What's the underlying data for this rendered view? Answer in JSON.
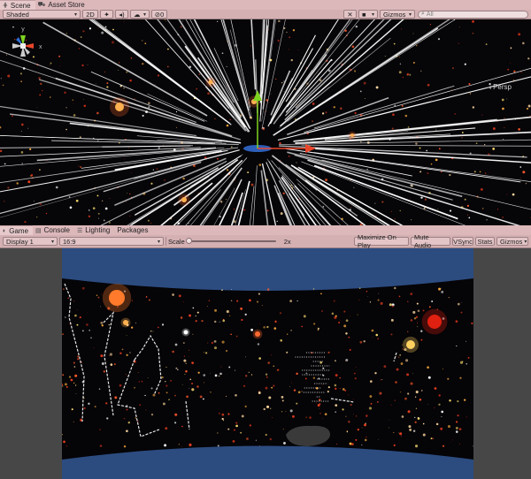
{
  "scene_panel": {
    "tabs": [
      {
        "label": "Scene",
        "icon": "grid-icon",
        "active": true
      },
      {
        "label": "Asset Store",
        "icon": "shopping-cart-icon",
        "active": false
      }
    ],
    "toolbar": {
      "shading_mode": "Shaded",
      "mode_2d": "2D",
      "gizmos": "Gizmos",
      "search_placeholder": "All",
      "hidden_count": "0"
    },
    "persp_label": "Persp",
    "axis_labels": {
      "y": "y",
      "x": "x"
    }
  },
  "game_panel": {
    "tabs": [
      {
        "label": "Game",
        "icon": "game-controller-icon",
        "active": true
      },
      {
        "label": "Console",
        "icon": "console-icon",
        "active": false
      },
      {
        "label": "Lighting",
        "icon": "lighting-icon",
        "active": false
      },
      {
        "label": "Packages",
        "icon": "package-icon",
        "active": false
      }
    ],
    "toolbar": {
      "display": "Display 1",
      "aspect": "16:9",
      "scale_label": "Scale",
      "scale_value": "2x",
      "maximize_on_play": "Maximize On Play",
      "mute_audio": "Mute Audio",
      "vsync": "VSync",
      "stats": "Stats",
      "gizmos": "Gizmos"
    }
  },
  "colors": {
    "tab_bar": "#dcb8bb",
    "toolbar": "#d4b0b3",
    "scene_background": "#060508",
    "game_sky": "#2c4c80",
    "gizmo_y": "#7ed321",
    "gizmo_x": "#e8462a",
    "gizmo_z": "#2f6fd6"
  }
}
